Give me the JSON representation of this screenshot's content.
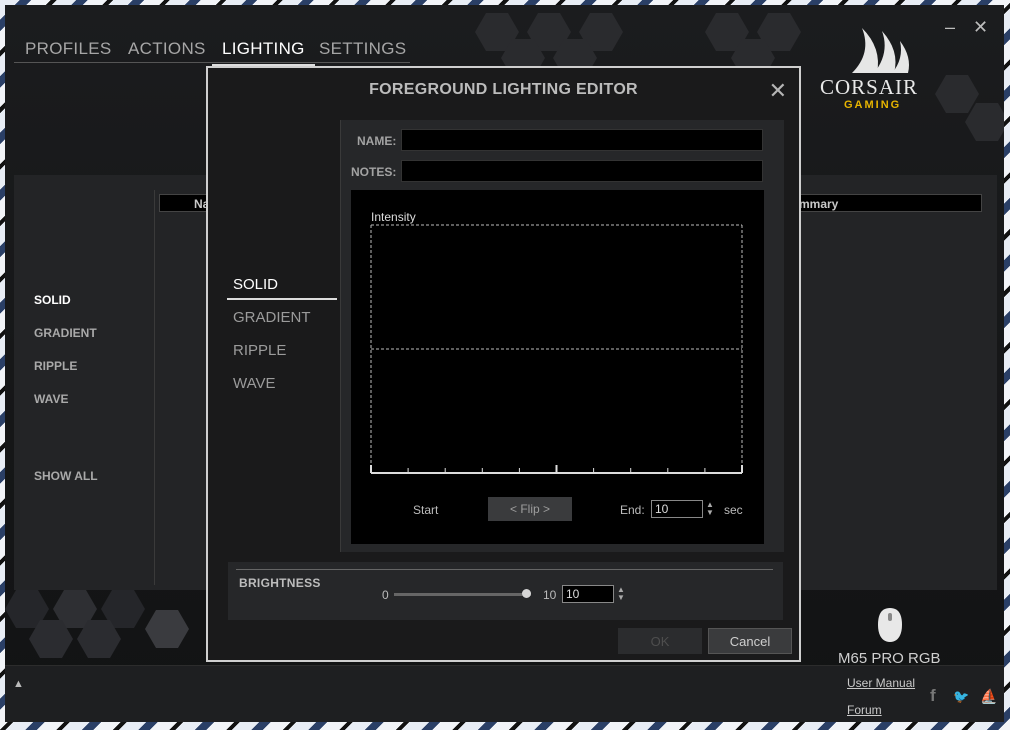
{
  "window": {
    "minimize_label": "–",
    "close_label": "✕"
  },
  "nav": {
    "tabs": [
      {
        "label": "PROFILES",
        "active": false
      },
      {
        "label": "ACTIONS",
        "active": false
      },
      {
        "label": "LIGHTING",
        "active": true
      },
      {
        "label": "SETTINGS",
        "active": false
      }
    ]
  },
  "brand": {
    "name": "CORSAIR",
    "sub": "GAMING"
  },
  "background_panel": {
    "col_name_partial": "Na",
    "col_summary_partial": "mmary",
    "effects": [
      "SOLID",
      "GRADIENT",
      "RIPPLE",
      "WAVE"
    ],
    "active_effect": "SOLID",
    "show_all": "SHOW ALL"
  },
  "device": {
    "name": "M65 PRO RGB",
    "icon": "mouse-icon"
  },
  "footer": {
    "user_manual": "User Manual",
    "forum": "Forum",
    "up_arrow": "▲",
    "social": [
      {
        "name": "facebook-icon",
        "glyph": "f"
      },
      {
        "name": "twitter-icon",
        "glyph": "🐦"
      },
      {
        "name": "corsair-sails-icon",
        "glyph": "⛵"
      }
    ]
  },
  "dialog": {
    "title": "FOREGROUND LIGHTING EDITOR",
    "close_label": "✕",
    "effects": [
      {
        "label": "SOLID",
        "active": true
      },
      {
        "label": "GRADIENT",
        "active": false
      },
      {
        "label": "RIPPLE",
        "active": false
      },
      {
        "label": "WAVE",
        "active": false
      }
    ],
    "name_label": "NAME:",
    "name_value": "",
    "notes_label": "NOTES:",
    "notes_value": "",
    "graph": {
      "intensity_label": "Intensity",
      "start_label": "Start",
      "flip_label": "< Flip >",
      "end_label": "End:",
      "end_value": "10",
      "sec_label": "sec",
      "tick_count": 10,
      "level": 0.5
    },
    "brightness": {
      "label": "BRIGHTNESS",
      "min": "0",
      "max": "10",
      "value": "10",
      "level": 1.0
    },
    "ok_label": "OK",
    "cancel_label": "Cancel"
  }
}
